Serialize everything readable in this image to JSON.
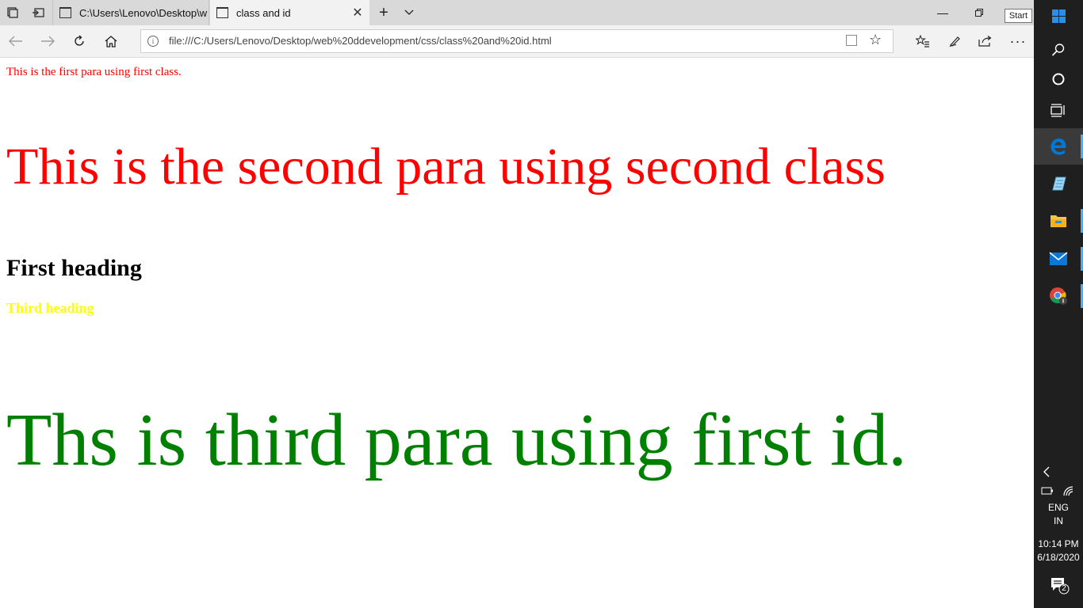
{
  "browser": {
    "tabs": [
      {
        "label": "C:\\Users\\Lenovo\\Desktop\\w",
        "active": false
      },
      {
        "label": "class and id",
        "active": true
      }
    ],
    "tooltip": "Start",
    "address_url": "file:///C:/Users/Lenovo/Desktop/web%20ddevelopment/css/class%20and%20id.html"
  },
  "page": {
    "para1": "This is the first para using first class.",
    "para2": "This is the second para using second class",
    "heading1": "First heading",
    "heading3": "Third heading",
    "para3": "Ths is third para using first id."
  },
  "taskbar": {
    "language": "ENG",
    "region": "IN",
    "time": "10:14 PM",
    "date": "6/18/2020",
    "notification_count": "2"
  },
  "colors": {
    "red_text": "#ff0000",
    "yellow_text": "#ffff00",
    "green_text": "#008000",
    "taskbar_bg": "#1f1f1f",
    "edge_blue": "#0078d7"
  }
}
